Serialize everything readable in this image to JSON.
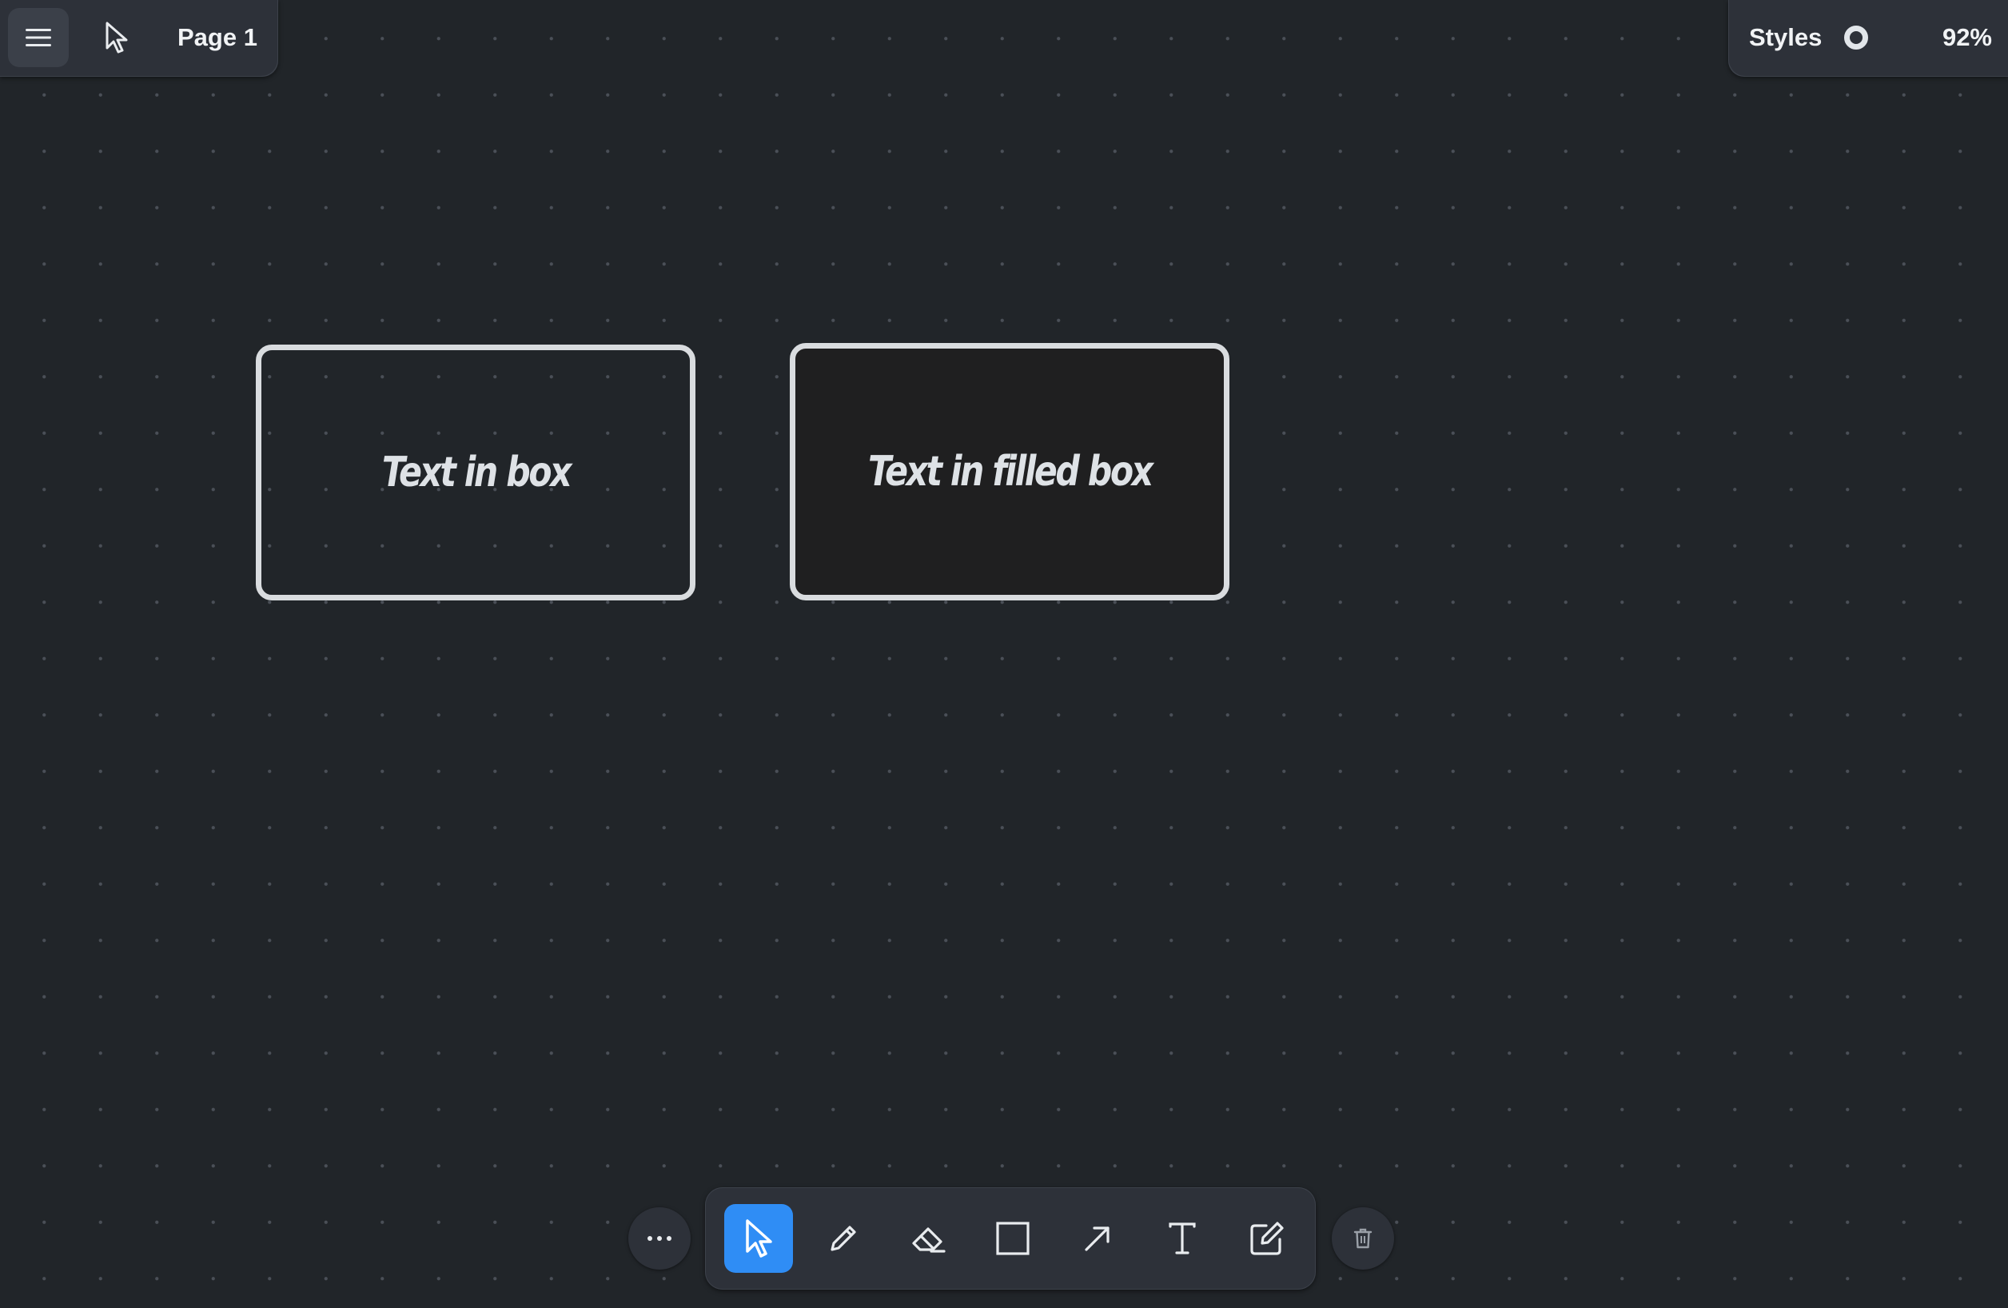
{
  "header": {
    "menu_icon": "hamburger-menu-icon",
    "cursor_icon": "cursor-icon",
    "page_name": "Page 1"
  },
  "style_panel": {
    "styles_label": "Styles",
    "swatch_icon": "ring-swatch-icon",
    "swatch_color": "#e2e6ea",
    "zoom_label": "92%"
  },
  "canvas": {
    "background_color": "#212529",
    "shapes": [
      {
        "kind": "rectangle",
        "fill": "none",
        "stroke_color": "#d9dcdf",
        "text": "Text in box"
      },
      {
        "kind": "rectangle",
        "fill": "#1f1f20",
        "stroke_color": "#d9dcdf",
        "text": "Text in filled box"
      }
    ]
  },
  "toolbar": {
    "more_icon": "more-horizontal-icon",
    "tools": [
      {
        "name": "select",
        "icon": "select-arrow-icon",
        "active": true
      },
      {
        "name": "draw",
        "icon": "pencil-icon",
        "active": false
      },
      {
        "name": "eraser",
        "icon": "eraser-icon",
        "active": false
      },
      {
        "name": "rectangle",
        "icon": "rectangle-icon",
        "active": false
      },
      {
        "name": "arrow",
        "icon": "arrow-icon",
        "active": false
      },
      {
        "name": "text",
        "icon": "text-icon",
        "active": false
      },
      {
        "name": "note",
        "icon": "note-edit-icon",
        "active": false
      }
    ],
    "trash_icon": "trash-icon",
    "accent_color": "#2f8df5"
  }
}
